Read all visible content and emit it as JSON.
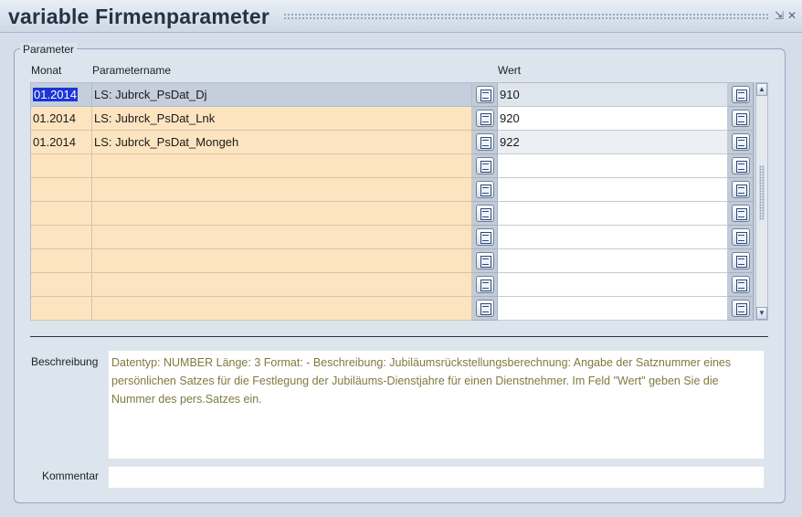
{
  "window": {
    "title": "variable Firmenparameter",
    "minimize_glyph": "⇲",
    "close_glyph": "✕"
  },
  "group": {
    "legend": "Parameter"
  },
  "columns": {
    "monat": "Monat",
    "parametername": "Parametername",
    "wert": "Wert"
  },
  "rows": [
    {
      "monat": "01.2014",
      "name": "LS: Jubrck_PsDat_Dj",
      "wert": "910",
      "selected": true
    },
    {
      "monat": "01.2014",
      "name": "LS: Jubrck_PsDat_Lnk",
      "wert": "920"
    },
    {
      "monat": "01.2014",
      "name": "LS: Jubrck_PsDat_Mongeh",
      "wert": "922"
    },
    {
      "monat": "",
      "name": "",
      "wert": ""
    },
    {
      "monat": "",
      "name": "",
      "wert": ""
    },
    {
      "monat": "",
      "name": "",
      "wert": ""
    },
    {
      "monat": "",
      "name": "",
      "wert": ""
    },
    {
      "monat": "",
      "name": "",
      "wert": ""
    },
    {
      "monat": "",
      "name": "",
      "wert": ""
    },
    {
      "monat": "",
      "name": "",
      "wert": ""
    }
  ],
  "icons": {
    "row_lov": "list-of-values-icon",
    "scroll_up": "arrow-up-icon",
    "scroll_down": "arrow-down-icon"
  },
  "scroll": {
    "up_glyph": "▲",
    "down_glyph": "▼"
  },
  "beschreibung": {
    "label": "Beschreibung",
    "text": "Datentyp: NUMBER Länge: 3 Format: - Beschreibung: Jubiläumsrückstellungsberechnung: Angabe der Satznummer eines persönlichen Satzes für die Festlegung der Jubiläums-Dienstjahre für einen Dienstnehmer. Im Feld \"Wert\" geben Sie die Nummer des pers.Satzes ein."
  },
  "kommentar": {
    "label": "Kommentar",
    "value": ""
  },
  "colors": {
    "row_bg": "#fde4c0",
    "selection": "#1c35d6",
    "desc_text": "#7f7a3e"
  }
}
